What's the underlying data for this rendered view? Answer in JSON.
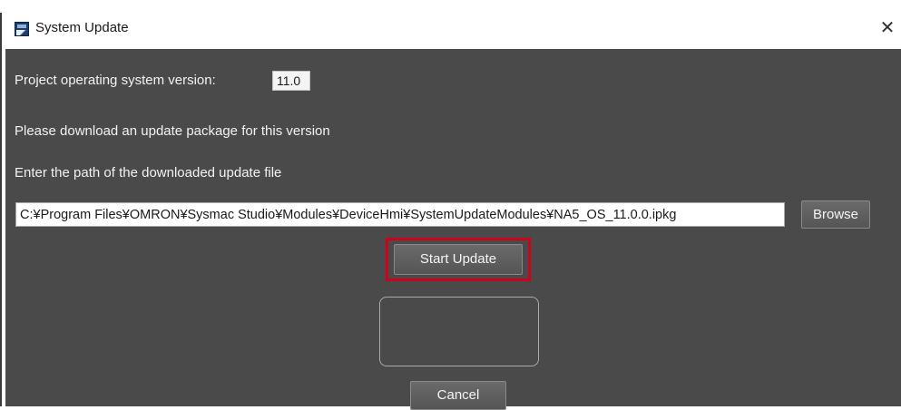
{
  "window": {
    "title": "System Update",
    "close_glyph": "✕",
    "icon": "sysmac-app-icon"
  },
  "form": {
    "os_version_label": "Project operating system version:",
    "os_version_value": "11.0",
    "download_prompt": "Please download an update package for this version",
    "path_prompt": "Enter the path of the downloaded update file",
    "path_value": "C:¥Program Files¥OMRON¥Sysmac Studio¥Modules¥DeviceHmi¥SystemUpdateModules¥NA5_OS_11.0.0.ipkg"
  },
  "buttons": {
    "browse": "Browse",
    "start_update": "Start Update",
    "cancel": "Cancel"
  },
  "colors": {
    "content_bg": "#4a4a4a",
    "highlight": "#d0021b"
  }
}
